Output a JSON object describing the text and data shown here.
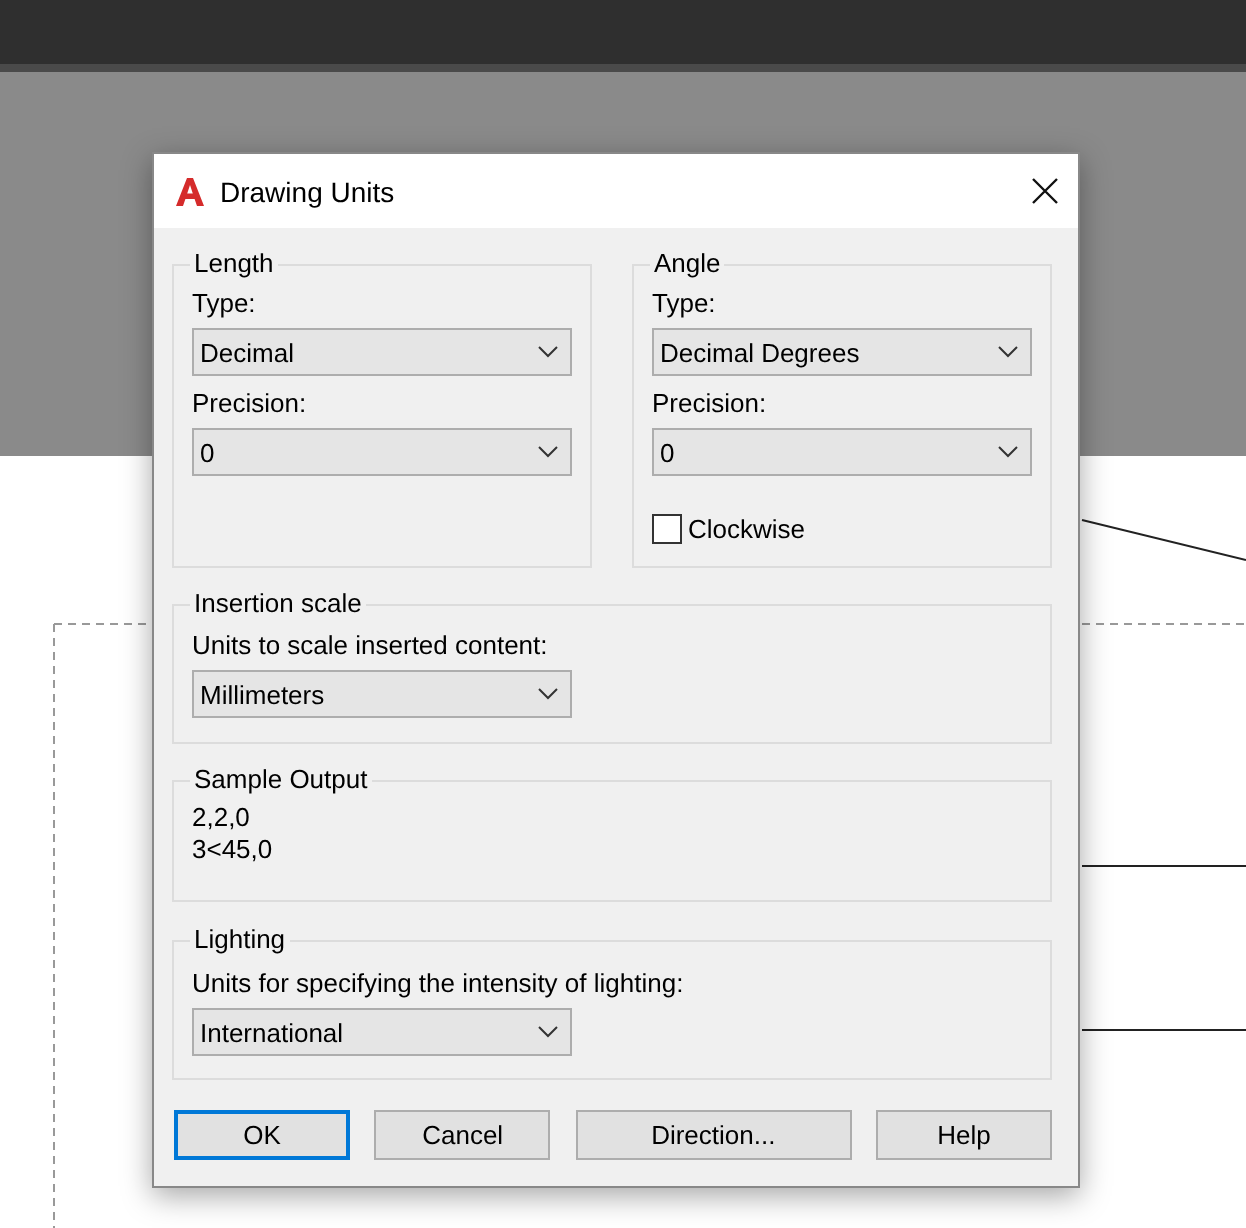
{
  "dialog": {
    "title": "Drawing Units"
  },
  "length": {
    "title": "Length",
    "type_label": "Type:",
    "type_value": "Decimal",
    "precision_label": "Precision:",
    "precision_value": "0"
  },
  "angle": {
    "title": "Angle",
    "type_label": "Type:",
    "type_value": "Decimal Degrees",
    "precision_label": "Precision:",
    "precision_value": "0",
    "clockwise": {
      "label": "Clockwise",
      "checked": false
    }
  },
  "insertion_scale": {
    "title": "Insertion scale",
    "label": "Units to scale inserted content:",
    "value": "Millimeters"
  },
  "sample_output": {
    "title": "Sample Output",
    "lines": [
      "2,2,0",
      "3<45,0"
    ]
  },
  "lighting": {
    "title": "Lighting",
    "label": "Units for specifying the intensity of lighting:",
    "value": "International"
  },
  "buttons": [
    {
      "label": "OK",
      "default": true
    },
    {
      "label": "Cancel",
      "default": false
    },
    {
      "label": "Direction...",
      "default": false
    },
    {
      "label": "Help",
      "default": false
    }
  ]
}
